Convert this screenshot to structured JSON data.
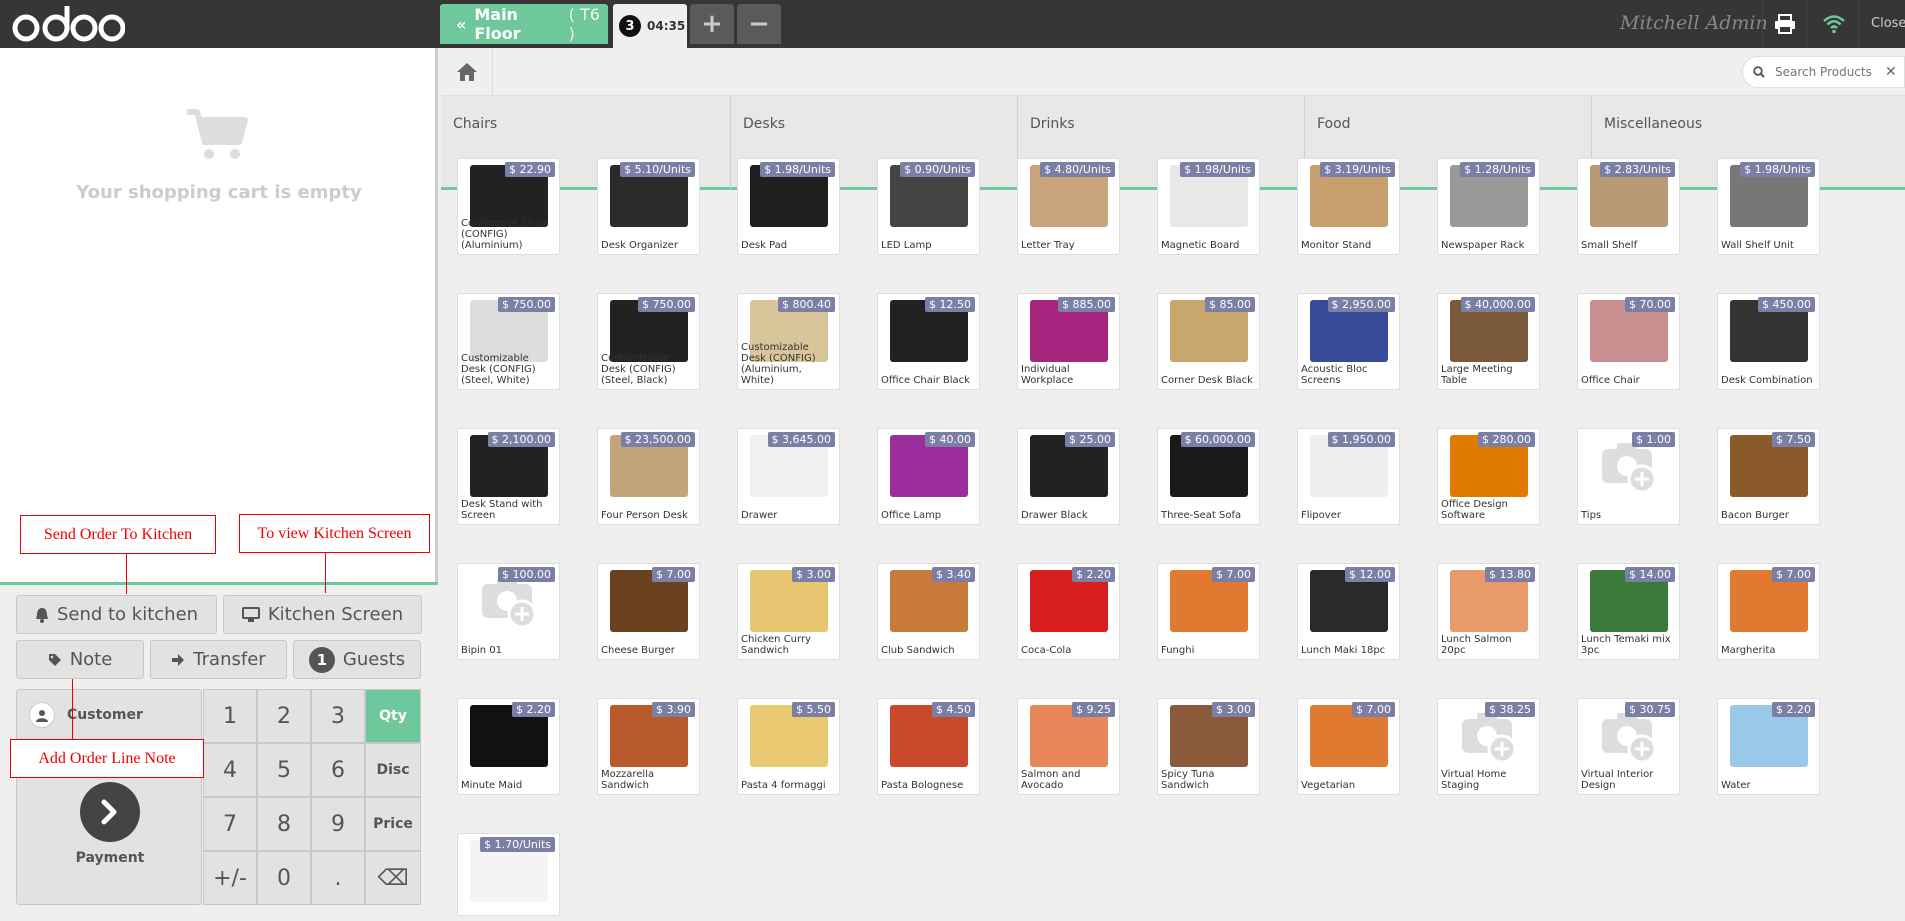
{
  "header": {
    "logo_text": "odoo",
    "floor_label": "Main Floor",
    "table_label": "( T6 )",
    "order_number": "3",
    "order_time": "04:35",
    "add_label": "+",
    "remove_label": "−",
    "user_name": "Mitchell Admin",
    "close_label": "Close",
    "wifi_color": "#6ec89b"
  },
  "cart": {
    "empty_text": "Your shopping cart is empty"
  },
  "actions": {
    "send_kitchen": "Send to kitchen",
    "kitchen_screen": "Kitchen Screen",
    "note": "Note",
    "transfer": "Transfer",
    "guests_count": "1",
    "guests": "Guests",
    "customer": "Customer",
    "payment": "Payment"
  },
  "numpad": {
    "keys": [
      "1",
      "2",
      "3",
      "Qty",
      "4",
      "5",
      "6",
      "Disc",
      "7",
      "8",
      "9",
      "Price",
      "+/-",
      "0",
      ".",
      "⌫"
    ]
  },
  "annotations": {
    "send_order": "Send Order To Kitchen",
    "view_kitchen": "To view Kitchen Screen",
    "order_note": "Add Order Line Note"
  },
  "search": {
    "placeholder": "Search Products"
  },
  "categories": [
    "Chairs",
    "Desks",
    "Drinks",
    "Food",
    "Miscellaneous"
  ],
  "products": [
    {
      "name": "Conference Chair (CONFIG) (Aluminium)",
      "price": "$ 22.90",
      "color": "#222"
    },
    {
      "name": "Desk Organizer",
      "price": "$ 5.10/Units",
      "color": "#2b2b2b"
    },
    {
      "name": "Desk Pad",
      "price": "$ 1.98/Units",
      "color": "#1f1f1f"
    },
    {
      "name": "LED Lamp",
      "price": "$ 0.90/Units",
      "color": "#444"
    },
    {
      "name": "Letter Tray",
      "price": "$ 4.80/Units",
      "color": "#c9a37a"
    },
    {
      "name": "Magnetic Board",
      "price": "$ 1.98/Units",
      "color": "#e8e8e8"
    },
    {
      "name": "Monitor Stand",
      "price": "$ 3.19/Units",
      "color": "#c8a070"
    },
    {
      "name": "Newspaper Rack",
      "price": "$ 1.28/Units",
      "color": "#999"
    },
    {
      "name": "Small Shelf",
      "price": "$ 2.83/Units",
      "color": "#b89a74"
    },
    {
      "name": "Wall Shelf Unit",
      "price": "$ 1.98/Units",
      "color": "#777"
    },
    {
      "name": "Customizable Desk (CONFIG) (Steel, White)",
      "price": "$ 750.00",
      "color": "#ddd"
    },
    {
      "name": "Customizable Desk (CONFIG) (Steel, Black)",
      "price": "$ 750.00",
      "color": "#222"
    },
    {
      "name": "Customizable Desk (CONFIG) (Aluminium, White)",
      "price": "$ 800.40",
      "color": "#d9c59a"
    },
    {
      "name": "Office Chair Black",
      "price": "$ 12.50",
      "color": "#222"
    },
    {
      "name": "Individual Workplace",
      "price": "$ 885.00",
      "color": "#a8257f"
    },
    {
      "name": "Corner Desk Black",
      "price": "$ 85.00",
      "color": "#c8a76c"
    },
    {
      "name": "Acoustic Bloc Screens",
      "price": "$ 2,950.00",
      "color": "#3a4a9a"
    },
    {
      "name": "Large Meeting Table",
      "price": "$ 40,000.00",
      "color": "#7a5a3a"
    },
    {
      "name": "Office Chair",
      "price": "$ 70.00",
      "color": "#c98f8f"
    },
    {
      "name": "Desk Combination",
      "price": "$ 450.00",
      "color": "#333"
    },
    {
      "name": "Desk Stand with Screen",
      "price": "$ 2,100.00",
      "color": "#222"
    },
    {
      "name": "Four Person Desk",
      "price": "$ 23,500.00",
      "color": "#c4a47a"
    },
    {
      "name": "Drawer",
      "price": "$ 3,645.00",
      "color": "#f0f0f0"
    },
    {
      "name": "Office Lamp",
      "price": "$ 40.00",
      "color": "#9b2e9b"
    },
    {
      "name": "Drawer Black",
      "price": "$ 25.00",
      "color": "#222"
    },
    {
      "name": "Three-Seat Sofa",
      "price": "$ 60,000.00",
      "color": "#1a1a1a"
    },
    {
      "name": "Flipover",
      "price": "$ 1,950.00",
      "color": "#eee"
    },
    {
      "name": "Office Design Software",
      "price": "$ 280.00",
      "color": "#e07b00"
    },
    {
      "name": "Tips",
      "price": "$ 1.00",
      "color": "placeholder"
    },
    {
      "name": "Bacon Burger",
      "price": "$ 7.50",
      "color": "#8a5a2a"
    },
    {
      "name": "Bipin 01",
      "price": "$ 100.00",
      "color": "placeholder"
    },
    {
      "name": "Cheese Burger",
      "price": "$ 7.00",
      "color": "#6a4220"
    },
    {
      "name": "Chicken Curry Sandwich",
      "price": "$ 3.00",
      "color": "#e6c670"
    },
    {
      "name": "Club Sandwich",
      "price": "$ 3.40",
      "color": "#c87a3a"
    },
    {
      "name": "Coca-Cola",
      "price": "$ 2.20",
      "color": "#d81e1e"
    },
    {
      "name": "Funghi",
      "price": "$ 7.00",
      "color": "#e07a30"
    },
    {
      "name": "Lunch Maki 18pc",
      "price": "$ 12.00",
      "color": "#2a2a2a"
    },
    {
      "name": "Lunch Salmon 20pc",
      "price": "$ 13.80",
      "color": "#e89a6a"
    },
    {
      "name": "Lunch Temaki mix 3pc",
      "price": "$ 14.00",
      "color": "#3a7a3a"
    },
    {
      "name": "Margherita",
      "price": "$ 7.00",
      "color": "#e07a30"
    },
    {
      "name": "Minute Maid",
      "price": "$ 2.20",
      "color": "#111"
    },
    {
      "name": "Mozzarella Sandwich",
      "price": "$ 3.90",
      "color": "#b85a2a"
    },
    {
      "name": "Pasta 4 formaggi",
      "price": "$ 5.50",
      "color": "#e8c870"
    },
    {
      "name": "Pasta Bolognese",
      "price": "$ 4.50",
      "color": "#c84a2a"
    },
    {
      "name": "Salmon and Avocado",
      "price": "$ 9.25",
      "color": "#e8885a"
    },
    {
      "name": "Spicy Tuna Sandwich",
      "price": "$ 3.00",
      "color": "#8a5a3a"
    },
    {
      "name": "Vegetarian",
      "price": "$ 7.00",
      "color": "#e07a30"
    },
    {
      "name": "Virtual Home Staging",
      "price": "$ 38.25",
      "color": "placeholder"
    },
    {
      "name": "Virtual Interior Design",
      "price": "$ 30.75",
      "color": "placeholder"
    },
    {
      "name": "Water",
      "price": "$ 2.20",
      "color": "#9ac8e8"
    },
    {
      "name": "",
      "price": "$ 1.70/Units",
      "color": "#f4f4f4"
    }
  ]
}
